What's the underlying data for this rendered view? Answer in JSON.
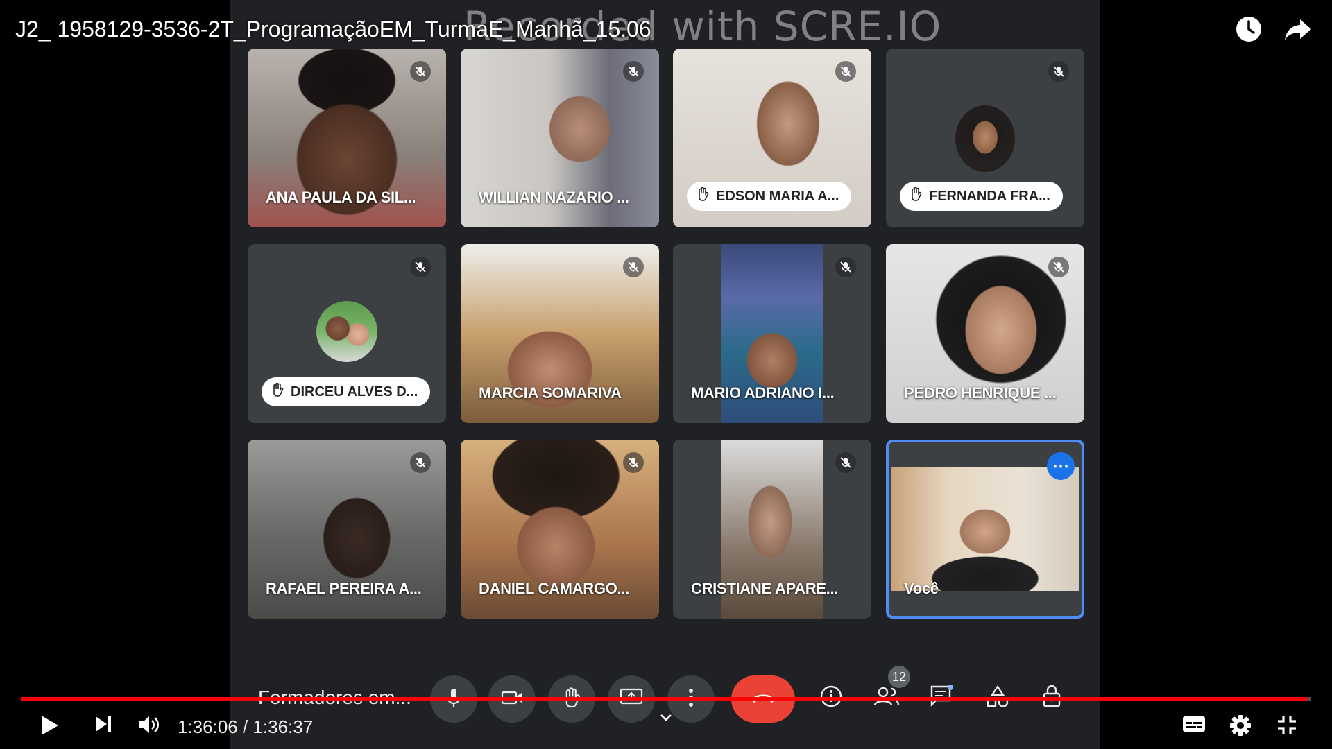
{
  "video": {
    "title": "J2_ 1958129-3536-2T_ProgramaçãoEM_TurmaE_Manhã_15.06",
    "watermark": "Recorded with SCRE.IO",
    "time_current": "1:36:06",
    "time_separator": " / ",
    "time_total": "1:36:37",
    "progress_fraction": 0.9966
  },
  "tiles": [
    {
      "label": "ANA PAULA DA SIL...",
      "kind": "video"
    },
    {
      "label": "WILLIAN NAZARIO ...",
      "kind": "video"
    },
    {
      "label": "EDSON MARIA A...",
      "kind": "pill"
    },
    {
      "label": "FERNANDA FRA...",
      "kind": "pill-avatar"
    },
    {
      "label": "DIRCEU ALVES D...",
      "kind": "pill-avatar"
    },
    {
      "label": "MARCIA SOMARIVA",
      "kind": "video"
    },
    {
      "label": "MARIO ADRIANO I...",
      "kind": "video"
    },
    {
      "label": "PEDRO HENRIQUE ...",
      "kind": "video"
    },
    {
      "label": "RAFAEL PEREIRA A...",
      "kind": "video"
    },
    {
      "label": "DANIEL CAMARGO...",
      "kind": "video"
    },
    {
      "label": "CRISTIANE APARE...",
      "kind": "video"
    },
    {
      "label": "Você",
      "kind": "self"
    }
  ],
  "meet": {
    "meeting_name": "Formadores em...",
    "participants_count": "12"
  },
  "colors": {
    "speaking": "#34e052",
    "accent": "#1a73e8",
    "hangup": "#ea4335",
    "progress": "#ff0000"
  },
  "icons": [
    "mic-off-icon",
    "hand-raise-icon",
    "clock-icon",
    "share-icon",
    "play-icon",
    "next-icon",
    "volume-icon",
    "chevron-down-icon",
    "subtitles-icon",
    "settings-icon",
    "exit-fullscreen-icon"
  ]
}
